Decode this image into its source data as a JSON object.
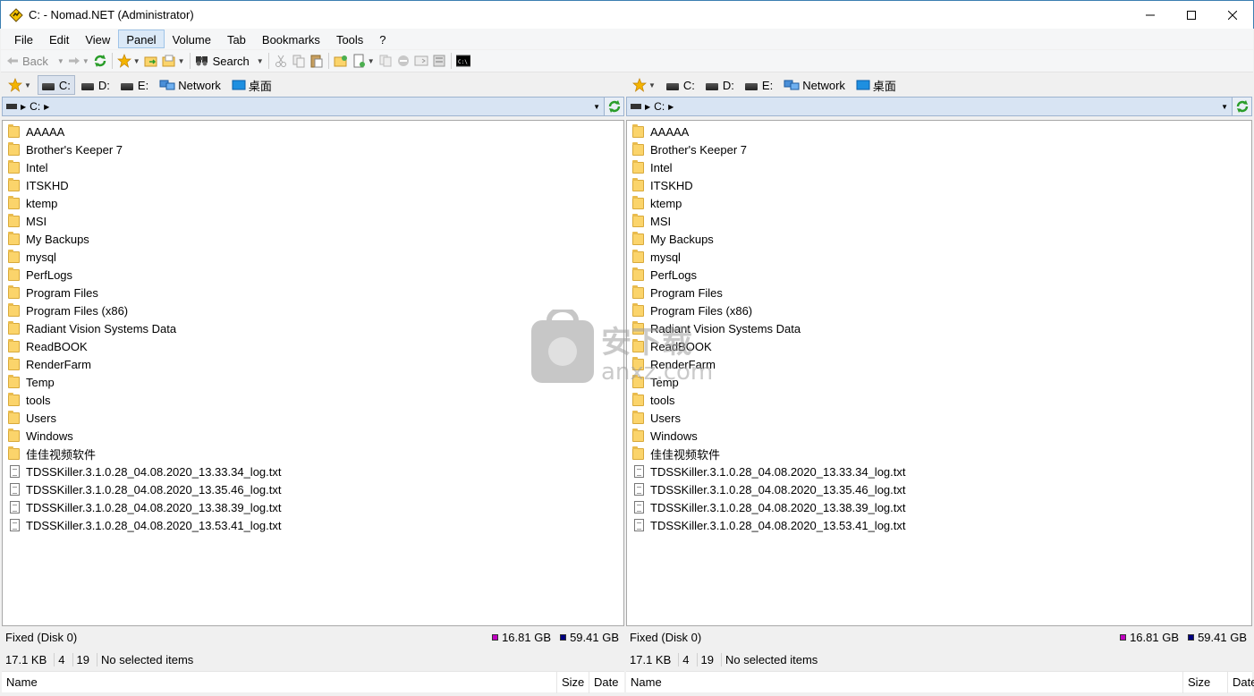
{
  "window": {
    "title": "C: - Nomad.NET (Administrator)"
  },
  "menu": [
    "File",
    "Edit",
    "View",
    "Panel",
    "Volume",
    "Tab",
    "Bookmarks",
    "Tools",
    "?"
  ],
  "menu_active": "Panel",
  "toolbar": {
    "back_label": "Back",
    "search_label": "Search"
  },
  "drives": [
    "C:",
    "D:",
    "E:"
  ],
  "network_label": "Network",
  "desktop_label": "桌面",
  "address": {
    "crumb": "C:"
  },
  "files": [
    {
      "name": "AAAAA",
      "type": "folder"
    },
    {
      "name": "Brother's Keeper 7",
      "type": "folder"
    },
    {
      "name": "Intel",
      "type": "folder"
    },
    {
      "name": "ITSKHD",
      "type": "folder"
    },
    {
      "name": "ktemp",
      "type": "folder"
    },
    {
      "name": "MSI",
      "type": "folder"
    },
    {
      "name": "My Backups",
      "type": "folder"
    },
    {
      "name": "mysql",
      "type": "folder"
    },
    {
      "name": "PerfLogs",
      "type": "folder"
    },
    {
      "name": "Program Files",
      "type": "folder"
    },
    {
      "name": "Program Files (x86)",
      "type": "folder"
    },
    {
      "name": "Radiant Vision Systems Data",
      "type": "folder"
    },
    {
      "name": "ReadBOOK",
      "type": "folder"
    },
    {
      "name": "RenderFarm",
      "type": "folder"
    },
    {
      "name": "Temp",
      "type": "folder"
    },
    {
      "name": "tools",
      "type": "folder"
    },
    {
      "name": "Users",
      "type": "folder"
    },
    {
      "name": "Windows",
      "type": "folder"
    },
    {
      "name": "佳佳视频软件",
      "type": "folder"
    },
    {
      "name": "TDSSKiller.3.1.0.28_04.08.2020_13.33.34_log.txt",
      "type": "file"
    },
    {
      "name": "TDSSKiller.3.1.0.28_04.08.2020_13.35.46_log.txt",
      "type": "file"
    },
    {
      "name": "TDSSKiller.3.1.0.28_04.08.2020_13.38.39_log.txt",
      "type": "file"
    },
    {
      "name": "TDSSKiller.3.1.0.28_04.08.2020_13.53.41_log.txt",
      "type": "file"
    }
  ],
  "status": {
    "disk": "Fixed (Disk 0)",
    "free": "16.81 GB",
    "total": "59.41 GB",
    "free_color": "#c000c0",
    "total_color": "#000080",
    "size": "17.1 KB",
    "folders": "4",
    "items": "19",
    "selection": "No selected items"
  },
  "columns": {
    "name": "Name",
    "size": "Size",
    "date": "Date"
  },
  "watermark": {
    "text": "安下载",
    "url": "anxz.com"
  }
}
